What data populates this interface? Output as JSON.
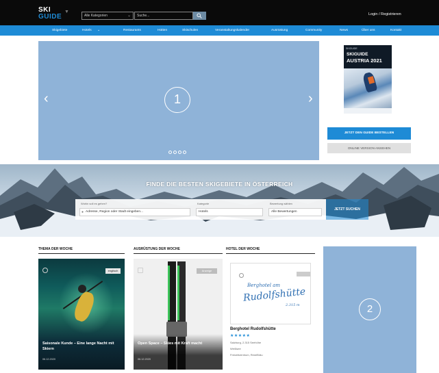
{
  "header": {
    "logo_line1": "SKI",
    "logo_line2": "GUIDE",
    "category_select": "Alle Kategorien",
    "search_placeholder": "Suche...",
    "auth": "Login / Registrieren"
  },
  "nav": {
    "items": [
      "Skigebiete",
      "Hotels",
      "Restaurants",
      "Hütten",
      "Skischulen",
      "Veranstaltungskalender",
      "Ausrüstung",
      "Community",
      "News",
      "Über uns",
      "Kontakt"
    ]
  },
  "hero": {
    "placeholder_number": "1",
    "prev_arrow": "‹",
    "next_arrow": "›",
    "dot_count": 4
  },
  "magazine": {
    "small_text": "SKIGUIDE",
    "title_line1": "SKIGUIDE",
    "title_line2": "AUSTRIA 2021",
    "order_button": "JETZT DEN GUIDE BESTELLEN",
    "online_button": "ONLINE VERSION ANSEHEN"
  },
  "search_banner": {
    "title": "FINDE DIE BESTEN SKIGEBIETE IN ÖSTERREICH",
    "where_label": "Wohin soll es gehen?",
    "where_placeholder": "Adresse, Region oder Stadt eingeben...",
    "category_label": "Kategorie",
    "category_value": "Hotels",
    "rating_label": "Bewertung wählen",
    "rating_value": "Alle Bewertungen",
    "search_button": "JETZT SUCHEN"
  },
  "sections": {
    "theme_title": "THEMA DER WOCHE",
    "equipment_title": "AUSRÜSTUNG DER WOCHE",
    "hotel_title": "HOTEL DER WOCHE"
  },
  "theme_card": {
    "badge": "englisch",
    "caption": "Saisonale Kunde – Eine lange Nacht mit Skiern",
    "date": "06.12.2020"
  },
  "equipment_card": {
    "badge": "Anzeige",
    "caption": "Open Space – Skies mit Kraft macht",
    "date": "06.12.2020"
  },
  "hotel_card": {
    "logo_line1": "Berghotel am",
    "logo_line2": "Rudolfshütte",
    "logo_alt": "2.315 m",
    "name": "Berghotel Rudolfshütte",
    "stars": "★★★★★",
    "line1": "Salzburg, 2.315 Seehöhe",
    "line2": "Weißsee",
    "line3": "Freizeitzentrum, Rest/Bräu"
  },
  "ad": {
    "placeholder_number": "2"
  },
  "colors": {
    "topbar": "#0a0a0a",
    "accent": "#1e8bd6",
    "placeholder": "#8fb3d8"
  }
}
